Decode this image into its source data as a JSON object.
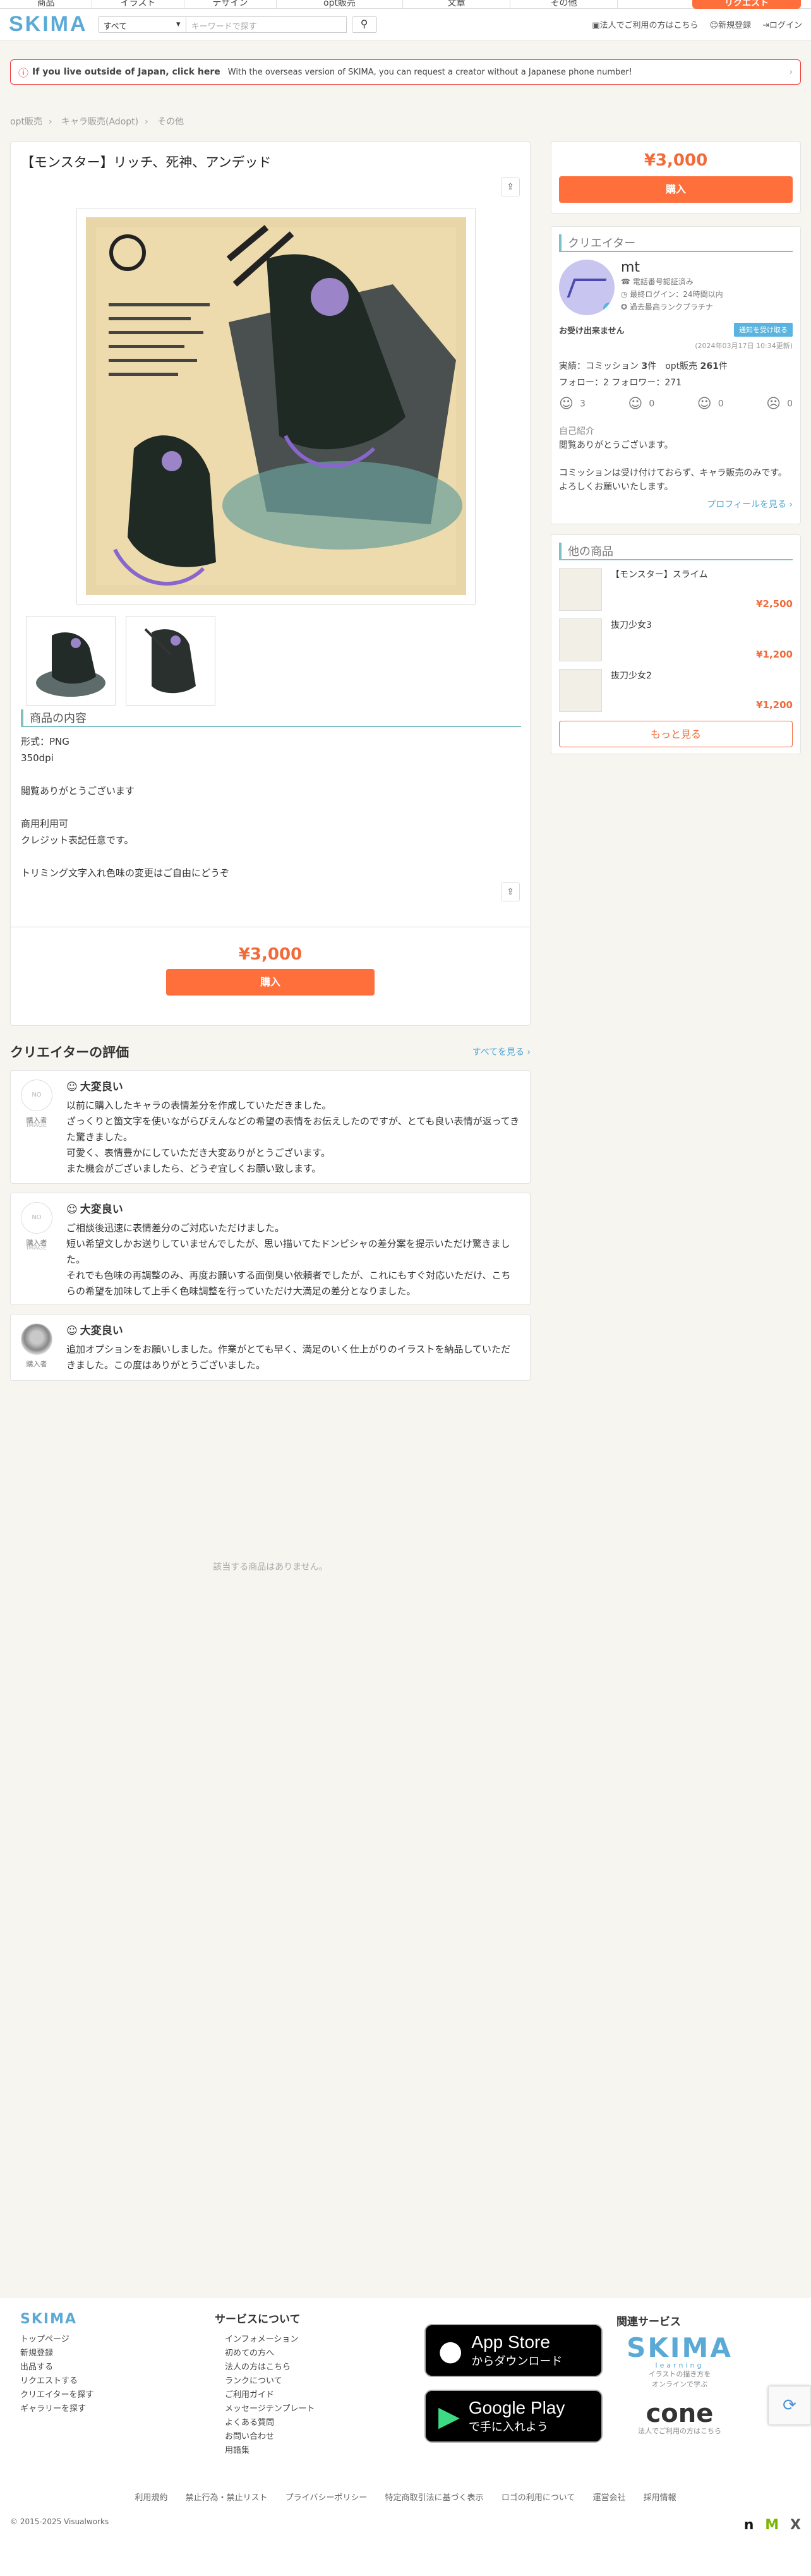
{
  "topnav": {
    "categories": [
      "商品",
      "イラスト",
      "デザイン",
      "opt販売",
      "文章",
      "その他"
    ],
    "cta": "リクエスト"
  },
  "header": {
    "logo": "SKIMA",
    "scope": "すべて",
    "search_placeholder": "キーワードで探す",
    "links": [
      "法人でご利用の方はこちら",
      "新規登録",
      "ログイン"
    ]
  },
  "notice": {
    "bold": "If you live outside of Japan, click here",
    "text": "With the overseas version of SKIMA, you can request a creator without a Japanese phone number!"
  },
  "breadcrumb": [
    "opt販売",
    "キャラ販売(Adopt)",
    "その他"
  ],
  "product": {
    "title": "【モンスター】リッチ、死神、アンデッド",
    "section_title": "商品の内容",
    "description": [
      "形式：PNG",
      "350dpi",
      "",
      "閲覧ありがとうございます",
      "",
      "商用利用可",
      "クレジット表記任意です。",
      "",
      "トリミング文字入れ色味の変更はご自由にどうぞ"
    ],
    "price": "¥3,000",
    "buy_label": "購入"
  },
  "reviews": {
    "heading": "クリエイターの評価",
    "see_all": "すべてを見る ›",
    "items": [
      {
        "rating": "大変良い",
        "role": "購入者",
        "avatar": "NO IMAGE",
        "lines": [
          "以前に購入したキャラの表情差分を作成していただきました。",
          "ざっくりと箇文字を使いながらびえんなどの希望の表情をお伝えしたのですが、とても良い表情が返ってきた驚きました。",
          "可愛く、表情豊かにしていただき大変ありがとうございます。",
          "また機会がございましたら、どうぞ宜しくお願い致します。"
        ]
      },
      {
        "rating": "大変良い",
        "role": "購入者",
        "avatar": "NO IMAGE",
        "lines": [
          "ご相談後迅速に表情差分のご対応いただけました。",
          "短い希望文しかお送りしていませんでしたが、思い描いてたドンピシャの差分案を提示いただけ驚きました。",
          "それでも色味の再調整のみ、再度お願いする面倒臭い依頼者でしたが、これにもすぐ対応いただけ、こちらの希望を加味して上手く色味調整を行っていただけ大満足の差分となりました。"
        ]
      },
      {
        "rating": "大変良い",
        "role": "購入者",
        "avatar": "",
        "lines": [
          "追加オプションをお願いしました。作業がとても早く、満足のいく仕上がりのイラストを納品していただきました。この度はありがとうございました。"
        ]
      }
    ],
    "no_related": "該当する商品はありません。"
  },
  "sidebar": {
    "price": "¥3,000",
    "buy_label": "購入",
    "creator": {
      "heading": "クリエイター",
      "name": "mt",
      "meta": [
        "電話番号認証済み",
        "最終ログイン：24時間以内",
        "過去最高ランクプラチナ"
      ],
      "status": "お受け出来ません",
      "status_tag": "通知を受け取る",
      "date": "(2024年03月17日 10:34更新)",
      "stats_line1_a": "実績：コミッション ",
      "stats_line1_b": "3",
      "stats_line1_c": "件　opt販売 ",
      "stats_line1_d": "261",
      "stats_line1_e": "件",
      "stats_line2": "フォロー：2 フォロワー：271",
      "faces": [
        "3",
        "0",
        "0",
        "0"
      ],
      "intro_label": "自己紹介",
      "intro": [
        "閲覧ありがとうございます。",
        "",
        "コミッションは受け付けておらず、キャラ販売のみです。",
        "よろしくお願いいたします。"
      ],
      "profile_link": "プロフィールを見る ›"
    },
    "others": {
      "heading": "他の商品",
      "items": [
        {
          "name": "【モンスター】スライム",
          "price": "¥2,500"
        },
        {
          "name": "抜刀少女3",
          "price": "¥1,200"
        },
        {
          "name": "抜刀少女2",
          "price": "¥1,200"
        }
      ],
      "more": "もっと見る"
    }
  },
  "footer": {
    "logo": "SKIMA",
    "col1": [
      "トップページ",
      "新規登録",
      "出品する",
      "リクエストする",
      "クリエイターを探す",
      "ギャラリーを探す"
    ],
    "col2_title": "サービスについて",
    "col2": [
      "インフォメーション",
      "初めての方へ",
      "法人の方はこちら",
      "ランクについて",
      "ご利用ガイド",
      "メッセージテンプレート",
      "よくある質問",
      "お問い合わせ",
      "用語集"
    ],
    "appstore_1": "App Store",
    "appstore_2": "からダウンロード",
    "gplay_1": "Google Play",
    "gplay_2": "で手に入れよう",
    "related_title": "関連サービス",
    "rel_skima": "SKIMA",
    "rel_skima_sub": "learning",
    "rel_skima_cap": "イラストの描き方を\nオンラインで学ぶ",
    "rel_cone": "cone",
    "rel_cone_cap": "法人でご利用の方はこちら",
    "bar": [
      "利用規約",
      "禁止行為・禁止リスト",
      "プライバシーポリシー",
      "特定商取引法に基づく表示",
      "ロゴの利用について",
      "運営会社",
      "採用情報"
    ],
    "copyright": "© 2015-2025 Visualworks"
  },
  "colors": {
    "accent": "#ff6f3c",
    "link": "#4aa6d6",
    "section": "#7fc0c7"
  }
}
